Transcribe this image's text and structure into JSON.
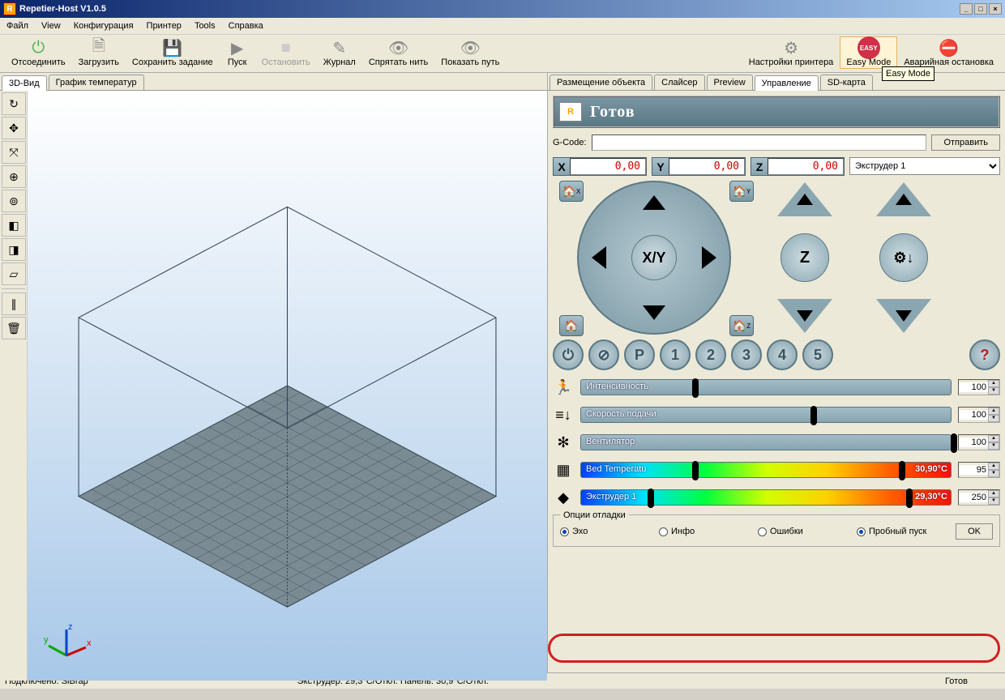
{
  "window": {
    "title": "Repetier-Host V1.0.5"
  },
  "menu": [
    "Файл",
    "View",
    "Конфигурация",
    "Принтер",
    "Tools",
    "Справка"
  ],
  "toolbar": [
    {
      "name": "connect-button",
      "label": "Отсоединить",
      "glyph": "⏻",
      "color": "#4caf50"
    },
    {
      "name": "load-button",
      "label": "Загрузить",
      "glyph": "🗎",
      "color": "#888"
    },
    {
      "name": "save-job-button",
      "label": "Сохранить задание",
      "glyph": "💾",
      "color": "#888"
    },
    {
      "name": "start-button",
      "label": "Пуск",
      "glyph": "▶",
      "color": "#888"
    },
    {
      "name": "stop-button",
      "label": "Остановить",
      "glyph": "■",
      "color": "#ccc",
      "disabled": true
    },
    {
      "name": "log-button",
      "label": "Журнал",
      "glyph": "✎",
      "color": "#888"
    },
    {
      "name": "hide-filament-button",
      "label": "Спрятать нить",
      "glyph": "👁",
      "color": "#888"
    },
    {
      "name": "show-path-button",
      "label": "Показать путь",
      "glyph": "👁",
      "color": "#888",
      "strike": true
    }
  ],
  "toolbar_right": [
    {
      "name": "printer-settings-button",
      "label": "Настройки принтера",
      "glyph": "⚙",
      "color": "#888"
    },
    {
      "name": "easy-mode-button",
      "label": "Easy Mode",
      "glyph": "EASY",
      "color": "#d03048",
      "active": true
    },
    {
      "name": "emergency-stop-button",
      "label": "Аварийная остановка",
      "glyph": "⛔",
      "color": "#e0a000"
    }
  ],
  "tooltip": "Easy Mode",
  "left_tabs": [
    {
      "name": "tab-3d-view",
      "label": "3D-Вид",
      "active": true
    },
    {
      "name": "tab-temp-graph",
      "label": "График температур"
    }
  ],
  "side_tools": [
    {
      "name": "refresh-icon",
      "glyph": "↻"
    },
    {
      "name": "move-icon",
      "glyph": "✥"
    },
    {
      "name": "pan-icon",
      "glyph": "⤧"
    },
    {
      "name": "zoom-in-icon",
      "glyph": "⊕"
    },
    {
      "name": "zoom-fit-icon",
      "glyph": "⊚"
    },
    {
      "name": "view-iso-icon",
      "glyph": "◧"
    },
    {
      "name": "view-front-icon",
      "glyph": "◨"
    },
    {
      "name": "view-top-icon",
      "glyph": "▱"
    },
    {
      "sep": true
    },
    {
      "name": "axes-icon",
      "glyph": "∥"
    },
    {
      "name": "delete-icon",
      "glyph": "🗑"
    }
  ],
  "right_tabs": [
    {
      "name": "tab-object-placement",
      "label": "Размещение объекта"
    },
    {
      "name": "tab-slicer",
      "label": "Слайсер"
    },
    {
      "name": "tab-preview",
      "label": "Preview"
    },
    {
      "name": "tab-control",
      "label": "Управление",
      "active": true
    },
    {
      "name": "tab-sd-card",
      "label": "SD-карта"
    }
  ],
  "status_text": "Готов",
  "gcode": {
    "label": "G-Code:",
    "value": "",
    "send": "Отправить"
  },
  "coords": {
    "x": "0,00",
    "y": "0,00",
    "z": "0,00"
  },
  "extruder_select": "Экструдер 1",
  "xy_label": "X/Y",
  "z_label": "Z",
  "speed_buttons": [
    "1",
    "2",
    "3",
    "4",
    "5"
  ],
  "sliders": [
    {
      "name": "speed-multiplier",
      "icon": "🏃",
      "label": "Интенсивность",
      "knob": 30,
      "value": "100"
    },
    {
      "name": "feedrate",
      "icon": "≡↓",
      "label": "Скорость подачи",
      "knob": 62,
      "value": "100"
    },
    {
      "name": "fan",
      "icon": "✻",
      "label": "Вентилятор",
      "knob": 100,
      "value": "100"
    },
    {
      "name": "bed-temp",
      "icon": "▦",
      "label": "Bed Temperatu",
      "knob": 30,
      "rainbow": true,
      "right": "30,90°C",
      "value": "95",
      "knob2": 86
    },
    {
      "name": "extruder-temp",
      "icon": "◆",
      "label": "Экструдер 1",
      "knob": 18,
      "rainbow": true,
      "right": "29,30°C",
      "value": "250",
      "knob2": 88,
      "highlight": true
    }
  ],
  "debug": {
    "title": "Опции отладки",
    "options": [
      {
        "name": "echo",
        "label": "Эхо",
        "on": true
      },
      {
        "name": "info",
        "label": "Инфо",
        "on": false
      },
      {
        "name": "errors",
        "label": "Ошибки",
        "on": false
      },
      {
        "name": "dry-run",
        "label": "Пробный пуск",
        "on": true
      }
    ],
    "ok": "OK"
  },
  "status": {
    "left": "Подключено: SiBrap",
    "mid": "Экструдер: 29,3°C/Откл. Панель: 30,9°C/Откл.",
    "right": "Готов"
  }
}
